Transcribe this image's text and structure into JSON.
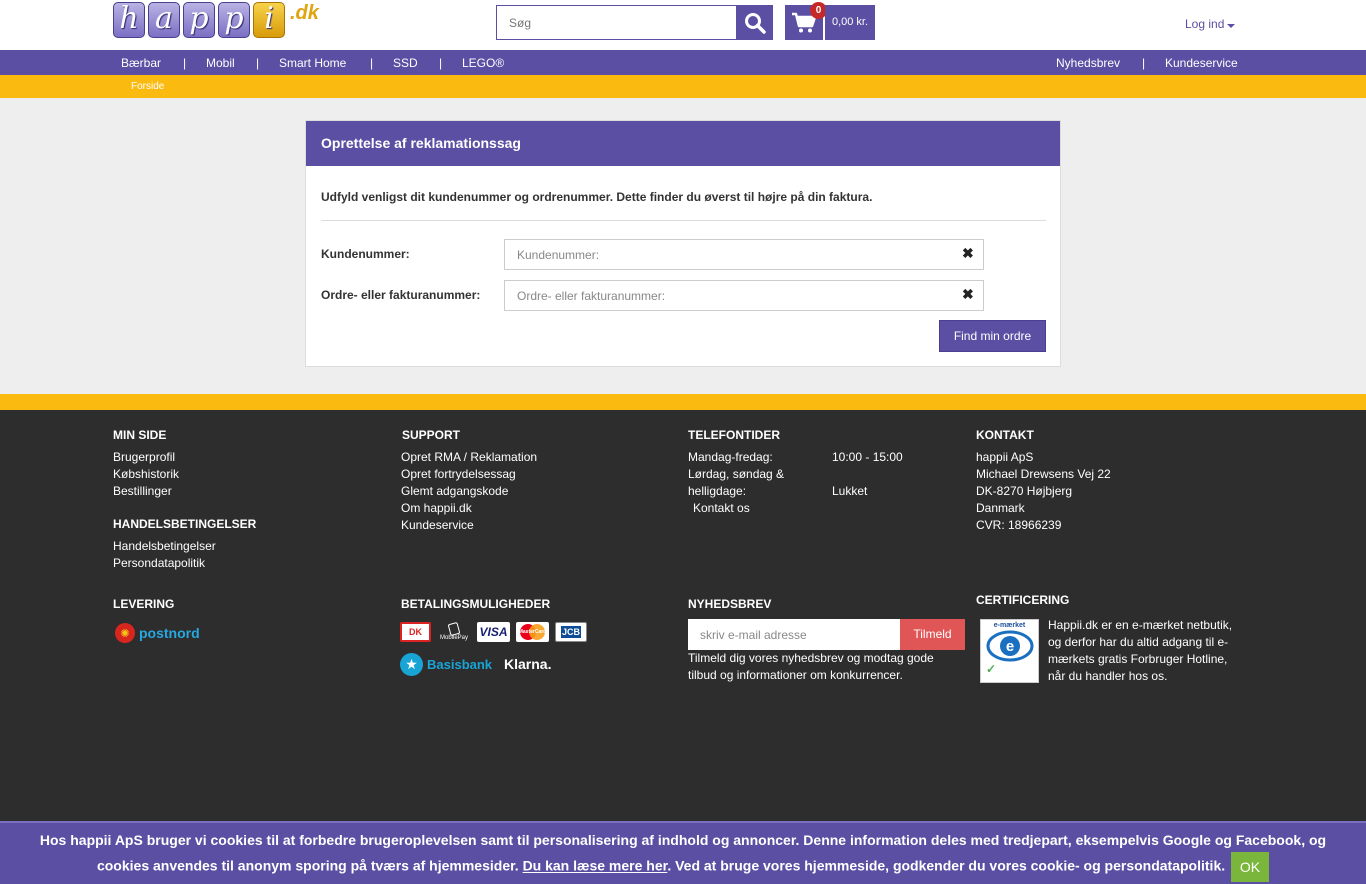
{
  "header": {
    "logo_letters": [
      "h",
      "a",
      "p",
      "p",
      "i"
    ],
    "logo_suffix": ".dk",
    "search_placeholder": "Søg",
    "cart_count": "0",
    "cart_total": "0,00 kr.",
    "login_label": "Log ind"
  },
  "nav": {
    "items": [
      "Bærbar",
      "Mobil",
      "Smart Home",
      "SSD",
      "LEGO®"
    ],
    "separator": "|",
    "right_items": [
      "Nyhedsbrev",
      "Kundeservice"
    ]
  },
  "breadcrumb": "Forside",
  "panel": {
    "title": "Oprettelse af reklamationssag",
    "intro": "Udfyld venligst dit kundenummer og ordrenummer. Dette finder du øverst til højre på din faktura.",
    "fields": [
      {
        "label": "Kundenummer:",
        "placeholder": "Kundenummer:",
        "value": ""
      },
      {
        "label": "Ordre- eller fakturanummer:",
        "placeholder": "Ordre- eller fakturanummer:",
        "value": ""
      }
    ],
    "clear_glyph": "✖",
    "submit_label": "Find min ordre"
  },
  "footer": {
    "min_side": {
      "title": "MIN SIDE",
      "links": [
        "Brugerprofil",
        "Købshistorik",
        "Bestillinger"
      ]
    },
    "handelsbetingelser": {
      "title": "HANDELSBETINGELSER",
      "links": [
        "Handelsbetingelser",
        "Persondatapolitik"
      ]
    },
    "support": {
      "title": "SUPPORT",
      "links": [
        "Opret RMA / Reklamation",
        "Opret fortrydelsessag",
        "Glemt adgangskode",
        "Om happii.dk",
        "Kundeservice"
      ]
    },
    "telefontider": {
      "title": "TELEFONTIDER",
      "row1_label": "Mandag-fredag:",
      "row1_value": "10:00 - 15:00",
      "row2_label_a": "Lørdag, søndag &",
      "row2_label_b": "helligdage:",
      "row2_value": "Lukket",
      "contact_link": "Kontakt os"
    },
    "kontakt": {
      "title": "KONTAKT",
      "lines": [
        "happii ApS",
        "Michael Drewsens Vej 22",
        "DK-8270 Højbjerg",
        "Danmark",
        "CVR: 18966239"
      ]
    },
    "levering": {
      "title": "LEVERING",
      "brand": "postnord"
    },
    "betaling": {
      "title": "BETALINGSMULIGHEDER",
      "logos": [
        "DK",
        "MobilePay",
        "VISA",
        "MasterCard",
        "JCB"
      ],
      "basisbank": "Basisbank",
      "klarna": "Klarna."
    },
    "nyhedsbrev": {
      "title": "NYHEDSBREV",
      "placeholder": "skriv e-mail adresse",
      "button": "Tilmeld",
      "text_a": "Tilmeld dig vores nyhedsbrev og modtag gode",
      "text_b": "tilbud og informationer om konkurrencer."
    },
    "certificering": {
      "title": "CERTIFICERING",
      "badge_label": "e-mærket",
      "lines": [
        "Happii.dk er en e-mærket netbutik,",
        "og derfor har du altid adgang til e-",
        "mærkets gratis Forbruger Hotline,",
        "når du handler hos os."
      ]
    }
  },
  "cookie": {
    "text_a": "Hos happii ApS bruger vi cookies til at forbedre brugeroplevelsen samt til personalisering af indhold og annoncer. Denne information deles med tredjepart, eksempelvis Google og Facebook, og",
    "text_b": "cookies anvendes til anonym sporing på tværs af hjemmesider.",
    "link": "Du kan læse mere her",
    "text_c": ". Ved at bruge vores hjemmeside, godkender du vores cookie- og persondatapolitik.",
    "ok": "OK"
  },
  "colors": {
    "brand_purple": "#5a4fa3",
    "accent_yellow": "#fbba10",
    "footer_bg": "#2d2d2d",
    "subscribe_red": "#e05656",
    "ok_green": "#79b63b"
  }
}
